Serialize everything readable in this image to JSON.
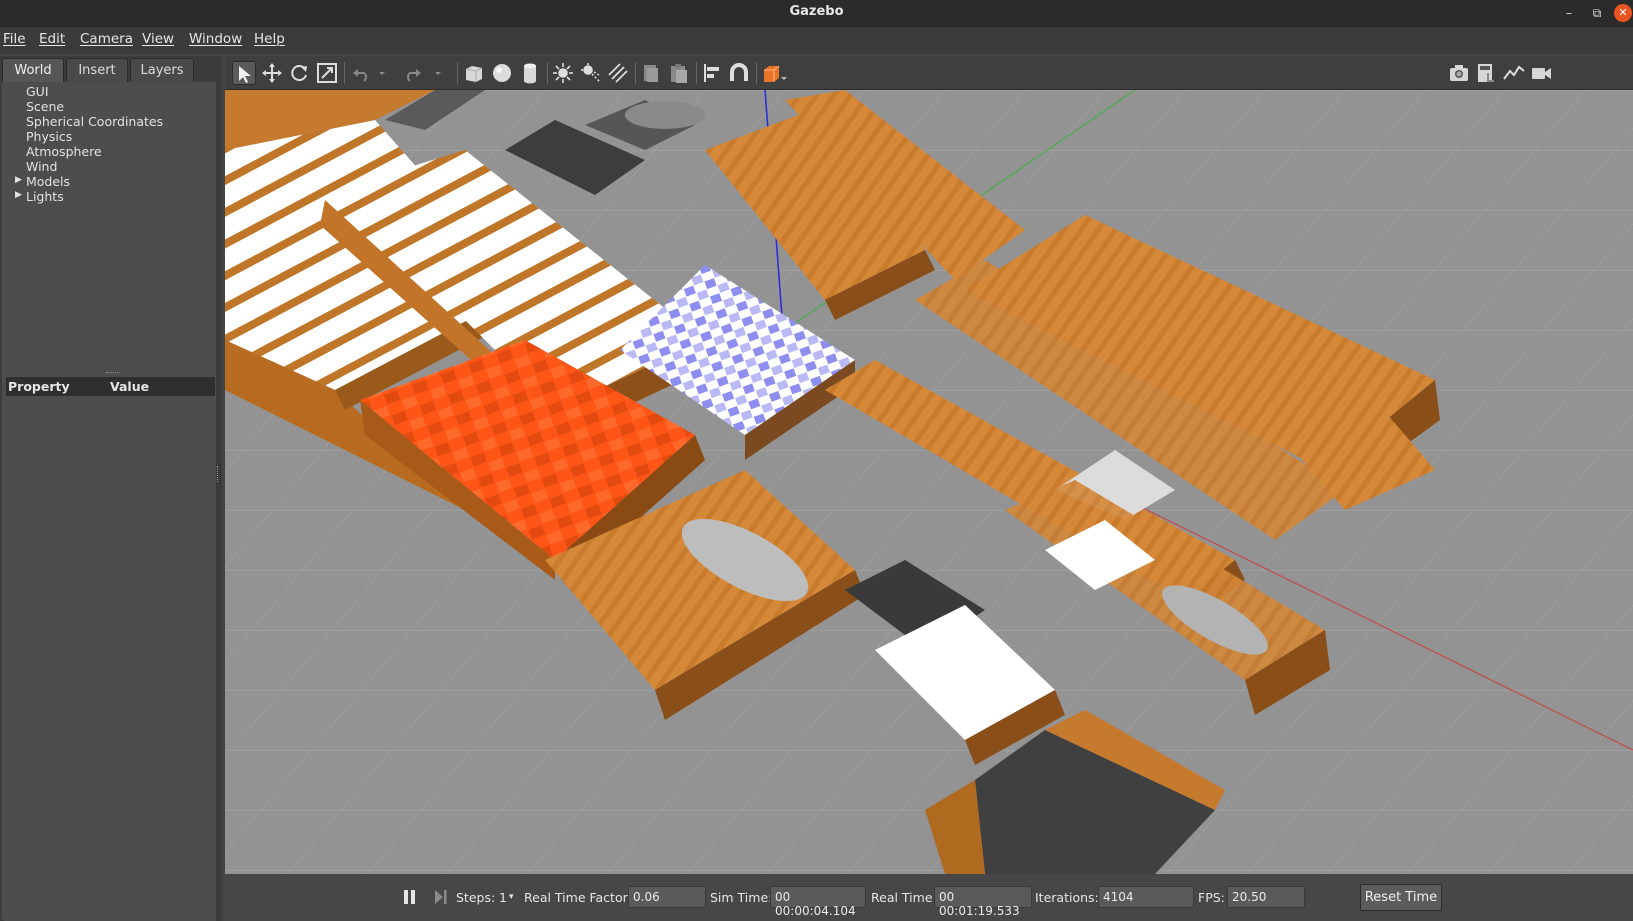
{
  "window": {
    "title": "Gazebo",
    "controls": [
      "minimize-icon",
      "restore-icon",
      "close-icon"
    ]
  },
  "menu": [
    "File",
    "Edit",
    "Camera",
    "View",
    "Window",
    "Help"
  ],
  "left_panel": {
    "tabs": [
      "World",
      "Insert",
      "Layers"
    ],
    "active_tab": "World",
    "tree": [
      {
        "label": "GUI",
        "expandable": false
      },
      {
        "label": "Scene",
        "expandable": false
      },
      {
        "label": "Spherical Coordinates",
        "expandable": false
      },
      {
        "label": "Physics",
        "expandable": false
      },
      {
        "label": "Atmosphere",
        "expandable": false
      },
      {
        "label": "Wind",
        "expandable": false
      },
      {
        "label": "Models",
        "expandable": true
      },
      {
        "label": "Lights",
        "expandable": true
      }
    ],
    "property_header": {
      "property": "Property",
      "value": "Value"
    }
  },
  "toolbar": {
    "tools": [
      "select-arrow-icon",
      "translate-icon",
      "rotate-icon",
      "scale-icon",
      "undo-icon",
      "undo-dropdown-icon",
      "redo-icon",
      "redo-dropdown-icon",
      "box-icon",
      "sphere-icon",
      "cylinder-icon",
      "point-light-icon",
      "spot-light-icon",
      "directional-light-icon",
      "copy-icon",
      "paste-icon",
      "align-icon",
      "snap-icon",
      "view-angle-icon"
    ],
    "right_tools": [
      "screenshot-icon",
      "log-icon",
      "plot-icon",
      "video-record-icon"
    ]
  },
  "viewport": {
    "description_colors": {
      "pallet_wood": "#c87a2c",
      "floor": "#9a9a9a",
      "grid": "#b0b0b0",
      "orange_boxes": "#ff5a1a",
      "white_boxes": "#ffffff",
      "dark_objects": "#3a3a3a"
    }
  },
  "bottom_bar": {
    "steps_label": "Steps:",
    "steps_value": "1",
    "real_time_factor_label": "Real Time Factor:",
    "real_time_factor": "0.06",
    "sim_time_label": "Sim Time:",
    "sim_time": "00 00:00:04.104",
    "real_time_label": "Real Time:",
    "real_time": "00 00:01:19.533",
    "iterations_label": "Iterations:",
    "iterations": "4104",
    "fps_label": "FPS:",
    "fps": "20.50",
    "reset_label": "Reset Time"
  }
}
